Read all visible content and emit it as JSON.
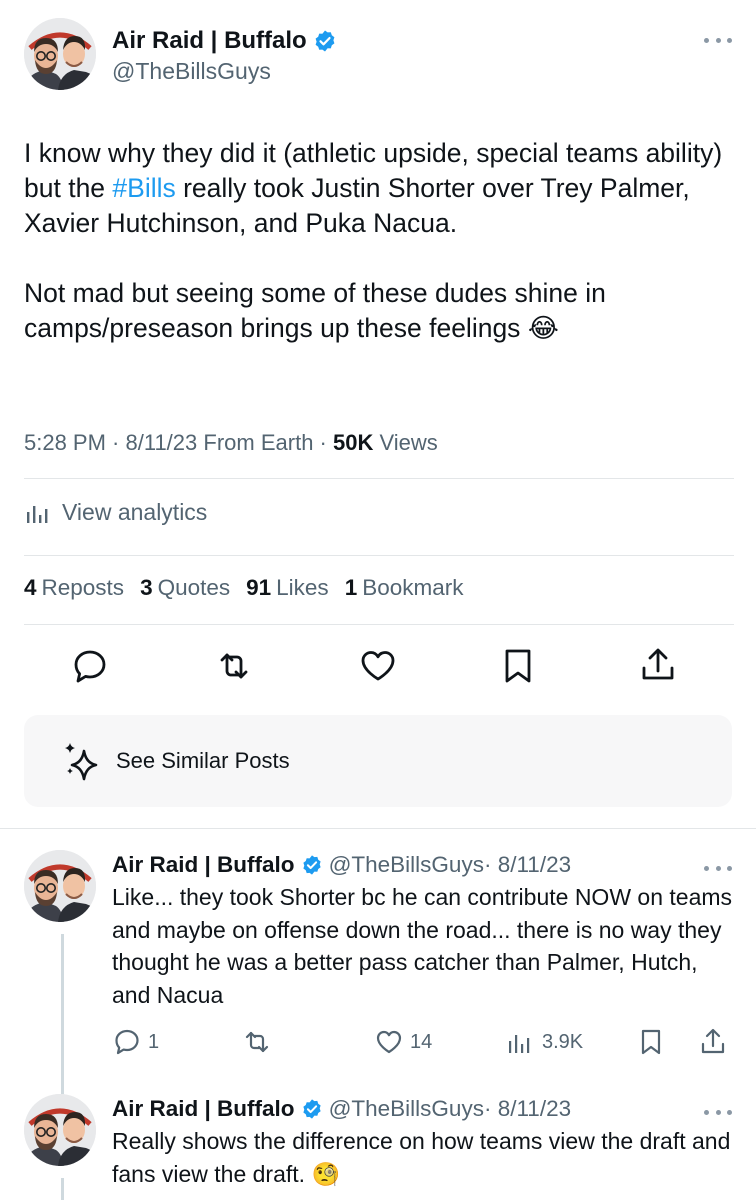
{
  "tweet": {
    "author_name": "Air Raid | Buffalo",
    "author_handle": "@TheBillsGuys",
    "text_p1_a": "I know why they did it (athletic upside, special teams ability) but the ",
    "hashtag": "#Bills",
    "text_p1_b": " really took Justin Shorter over Trey Palmer, Xavier Hutchinson, and Puka Nacua.",
    "text_p2": "Not mad but seeing some of these dudes shine in camps/preseason brings up these feelings",
    "emoji": "😂",
    "time": "5:28 PM",
    "date": "8/11/23",
    "source": "From Earth",
    "views_count": "50K",
    "views_label": "Views"
  },
  "analytics": {
    "label": "View analytics"
  },
  "stats": {
    "reposts_count": "4",
    "reposts_label": "Reposts",
    "quotes_count": "3",
    "quotes_label": "Quotes",
    "likes_count": "91",
    "likes_label": "Likes",
    "bookmarks_count": "1",
    "bookmarks_label": "Bookmark"
  },
  "actions": [
    "reply-icon",
    "repost-icon",
    "heart-icon",
    "bookmark-icon",
    "share-icon"
  ],
  "similar": {
    "label": "See Similar Posts"
  },
  "replies": [
    {
      "author_name": "Air Raid | Buffalo",
      "author_handle": "@TheBillsGuys",
      "date": "· 8/11/23",
      "text": "Like... they took Shorter bc he can contribute NOW on teams and maybe on offense down the road... there is no way they thought he was a better pass catcher than Palmer, Hutch, and Nacua",
      "reply_count": "1",
      "like_count": "14",
      "view_count": "3.9K"
    },
    {
      "author_name": "Air Raid | Buffalo",
      "author_handle": "@TheBillsGuys",
      "date": "· 8/11/23",
      "text": "Really shows the difference on how teams view the draft and fans view the draft.",
      "emoji": "🧐"
    }
  ],
  "colors": {
    "link": "#1d9bf0",
    "secondary_text": "#536471",
    "verified": "#1d9bf0"
  }
}
